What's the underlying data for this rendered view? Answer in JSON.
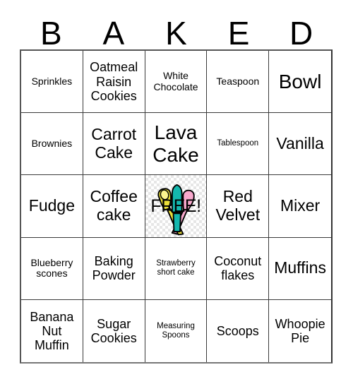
{
  "card": {
    "header_letters": [
      "B",
      "A",
      "K",
      "E",
      "D"
    ],
    "free_space": {
      "label": "FREE!",
      "art_name": "baking-utensils-clipart",
      "art_colors": {
        "spoon_yellow": "#ecdf3a",
        "spatula_teal": "#14b7ae",
        "spoon_pink": "#f8a8cd",
        "outline": "#000000"
      },
      "background": "transparency-checkerboard"
    },
    "colors": {
      "background": "#ffffff",
      "text": "#000000",
      "grid_line": "#3a3a3a",
      "grid_outer": "#555555",
      "checker_light": "#ffffff",
      "checker_dark": "#e6e6e6"
    },
    "rows": [
      [
        {
          "text": "Sprinkles",
          "size": "sm"
        },
        {
          "text": "Oatmeal Raisin Cookies",
          "size": "md"
        },
        {
          "text": "White Chocolate",
          "size": "sm"
        },
        {
          "text": "Teaspoon",
          "size": "sm"
        },
        {
          "text": "Bowl",
          "size": "xl"
        }
      ],
      [
        {
          "text": "Brownies",
          "size": "sm"
        },
        {
          "text": "Carrot Cake",
          "size": "lg"
        },
        {
          "text": "Lava Cake",
          "size": "xl"
        },
        {
          "text": "Tablespoon",
          "size": "xs"
        },
        {
          "text": "Vanilla",
          "size": "lg"
        }
      ],
      [
        {
          "text": "Fudge",
          "size": "lg"
        },
        {
          "text": "Coffee cake",
          "size": "lg"
        },
        {
          "text": "FREE!",
          "size": "free"
        },
        {
          "text": "Red Velvet",
          "size": "lg"
        },
        {
          "text": "Mixer",
          "size": "lg"
        }
      ],
      [
        {
          "text": "Blueberry scones",
          "size": "sm"
        },
        {
          "text": "Baking Powder",
          "size": "md"
        },
        {
          "text": "Strawberry short cake",
          "size": "xs"
        },
        {
          "text": "Coconut flakes",
          "size": "md"
        },
        {
          "text": "Muffins",
          "size": "lg"
        }
      ],
      [
        {
          "text": "Banana Nut Muffin",
          "size": "md"
        },
        {
          "text": "Sugar Cookies",
          "size": "md"
        },
        {
          "text": "Measuring Spoons",
          "size": "xs"
        },
        {
          "text": "Scoops",
          "size": "md"
        },
        {
          "text": "Whoopie Pie",
          "size": "md"
        }
      ]
    ]
  }
}
